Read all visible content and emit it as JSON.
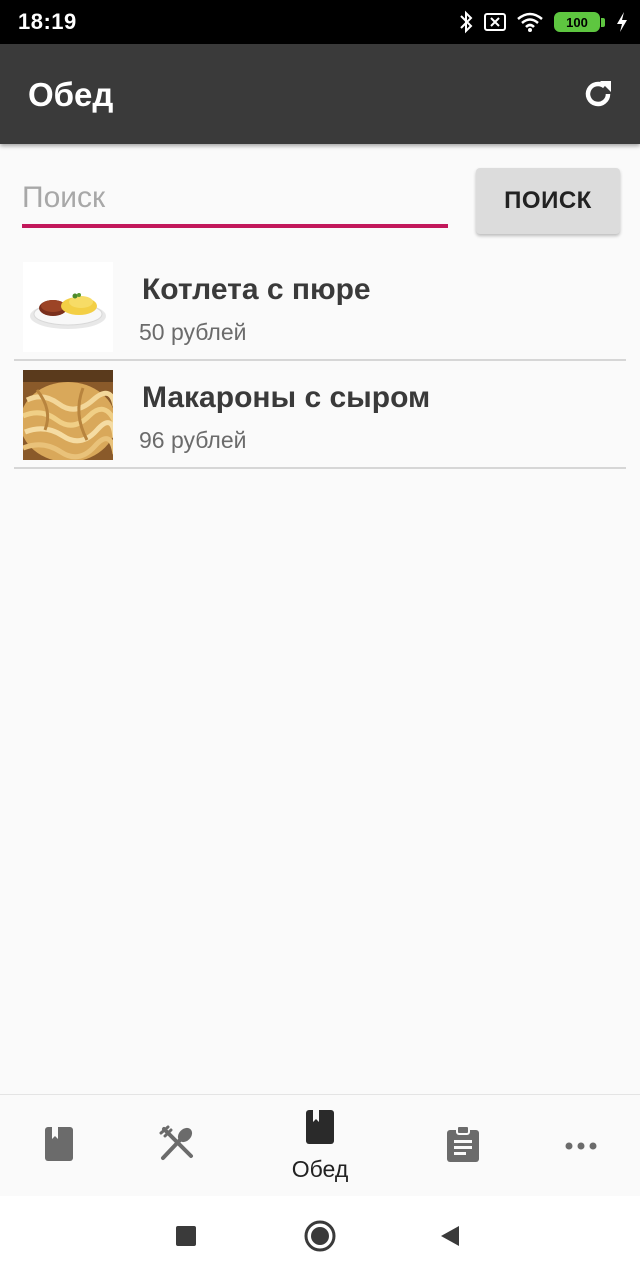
{
  "status_bar": {
    "time": "18:19",
    "battery_level": "100",
    "icons": [
      "bluetooth-icon",
      "sim-off-icon",
      "wifi-icon",
      "battery-icon",
      "charging-icon"
    ],
    "battery_color": "#5ec640"
  },
  "app_bar": {
    "title": "Обед",
    "action_icon": "refresh-icon",
    "background_color": "#3a3a3a"
  },
  "search": {
    "placeholder": "Поиск",
    "value": "",
    "button_label": "ПОИСК",
    "accent_color": "#c2185b"
  },
  "items": [
    {
      "name": "Котлета с пюре",
      "price": "50 рублей",
      "image": "cutlet-with-mash-photo"
    },
    {
      "name": "Макароны с сыром",
      "price": "96 рублей",
      "image": "pasta-with-cheese-photo"
    }
  ],
  "bottom_nav": {
    "items": [
      {
        "icon": "book-icon",
        "label": ""
      },
      {
        "icon": "fork-spoon-icon",
        "label": ""
      },
      {
        "icon": "book-active-icon",
        "label": "Обед",
        "selected": true
      },
      {
        "icon": "clipboard-icon",
        "label": ""
      },
      {
        "icon": "more-icon",
        "label": ""
      }
    ]
  },
  "system_nav": {
    "icons": [
      "recents-square-icon",
      "home-circle-icon",
      "back-triangle-icon"
    ]
  }
}
